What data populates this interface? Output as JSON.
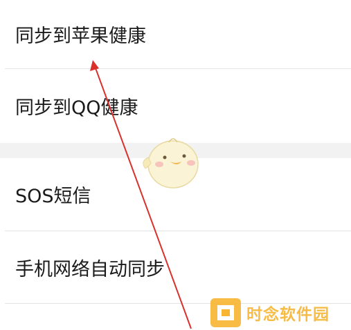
{
  "settings": {
    "items": [
      {
        "label": "同步到苹果健康"
      },
      {
        "label": "同步到QQ健康"
      },
      {
        "label": "SOS短信"
      },
      {
        "label": "手机网络自动同步"
      }
    ]
  },
  "watermark": {
    "text": "时念软件园",
    "brand_color": "#f7b531"
  },
  "annotation": {
    "arrow_color": "#d9302c"
  }
}
